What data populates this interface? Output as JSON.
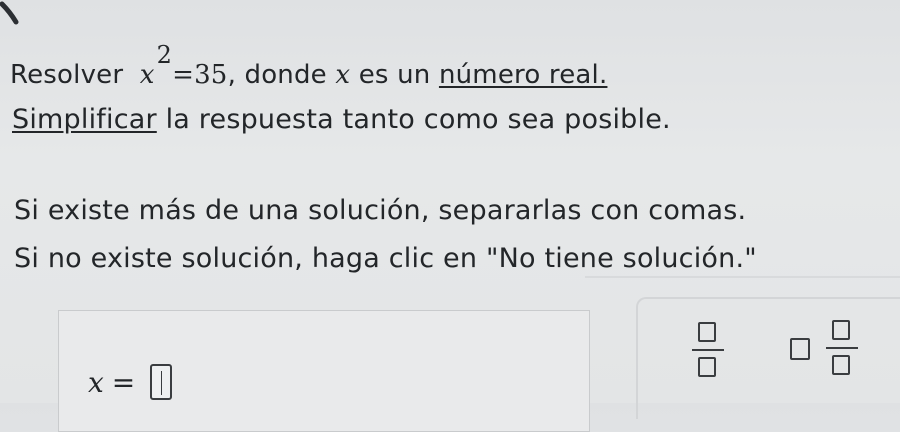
{
  "problem": {
    "resolver": "Resolver",
    "equation_base": "x",
    "equation_exp": "2",
    "equation_rest": "=35",
    "donde": ", donde",
    "var": "x",
    "es_un": "es un",
    "numero_real": "número real.",
    "simplificar": "Simplificar",
    "line2_rest": "la respuesta tanto como sea posible.",
    "line3": "Si existe más de una solución, separarlas con comas.",
    "line4": "Si no existe solución, haga clic en \"No tiene solución.\""
  },
  "answer": {
    "var": "x",
    "equals": "=",
    "value": ""
  },
  "toolbar": {
    "buttons": [
      {
        "icon": "fraction-icon"
      },
      {
        "icon": "mixed-number-icon"
      }
    ]
  }
}
